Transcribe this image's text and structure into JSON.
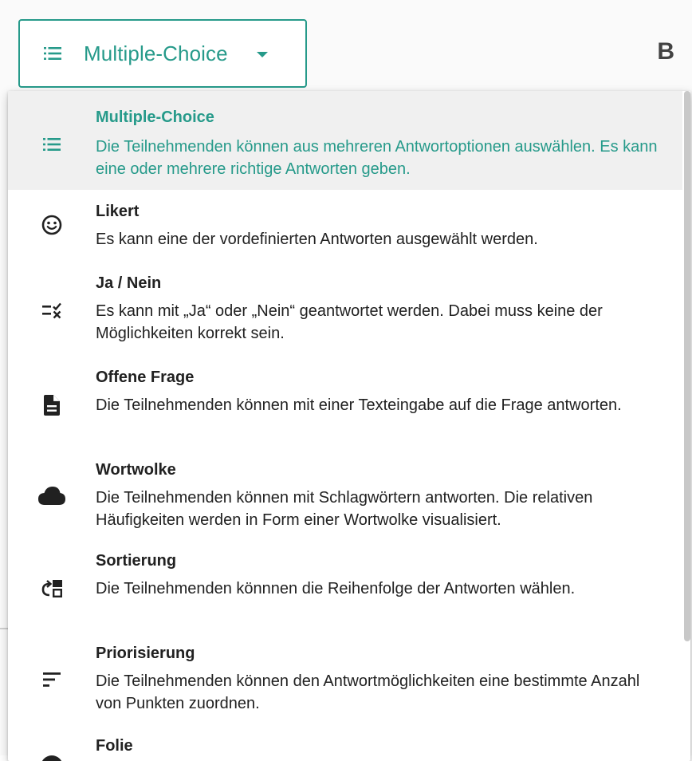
{
  "select": {
    "value": "Multiple-Choice",
    "icon": "list-icon"
  },
  "side_letter": "B",
  "accent_color": "#269a8a",
  "menu": {
    "items": [
      {
        "icon": "list-icon",
        "title": "Multiple-Choice",
        "description": "Die Teilnehmenden können aus mehreren Antwortoptionen auswählen. Es kann eine oder mehrere richtige Antworten geben.",
        "selected": true
      },
      {
        "icon": "smiley-icon",
        "title": "Likert",
        "description": "Es kann eine der vordefinierten Antworten ausgewählt werden.",
        "selected": false
      },
      {
        "icon": "checklist-icon",
        "title": "Ja / Nein",
        "description": "Es kann mit „Ja“ oder „Nein“ geantwortet werden. Dabei muss keine der Möglichkeiten korrekt sein.",
        "selected": false
      },
      {
        "icon": "document-icon",
        "title": "Offene Frage",
        "description": "Die Teilnehmenden können mit einer Texteingabe auf die Frage antworten.",
        "selected": false
      },
      {
        "icon": "cloud-icon",
        "title": "Wortwolke",
        "description": "Die Teilnehmenden können mit Schlagwörtern antworten. Die relativen Häufigkeiten werden in Form einer Wortwolke visualisiert.",
        "selected": false
      },
      {
        "icon": "sort-icon",
        "title": "Sortierung",
        "description": "Die Teilnehmenden könnnen die Reihenfolge der Antworten wählen.",
        "selected": false
      },
      {
        "icon": "priority-icon",
        "title": "Priorisierung",
        "description": "Die Teilnehmenden können den Antwortmöglichkeiten eine bestimmte Anzahl von Punkten zuordnen.",
        "selected": false
      },
      {
        "icon": "slide-icon",
        "title": "Folie",
        "description": "",
        "selected": false
      }
    ]
  }
}
